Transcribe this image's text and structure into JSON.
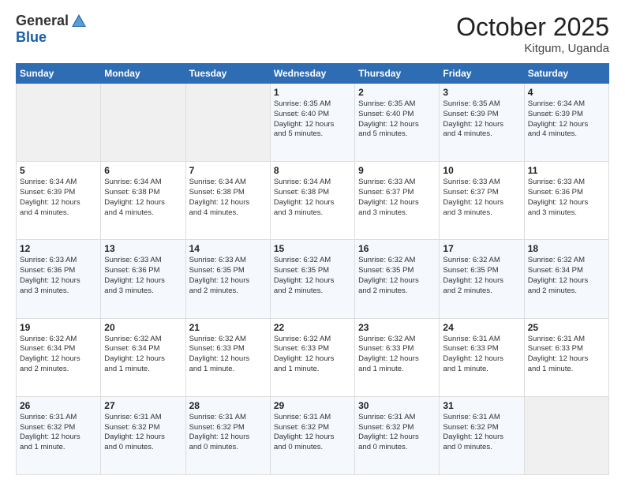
{
  "header": {
    "logo_general": "General",
    "logo_blue": "Blue",
    "month_title": "October 2025",
    "location": "Kitgum, Uganda"
  },
  "weekdays": [
    "Sunday",
    "Monday",
    "Tuesday",
    "Wednesday",
    "Thursday",
    "Friday",
    "Saturday"
  ],
  "weeks": [
    [
      {
        "day": "",
        "info": ""
      },
      {
        "day": "",
        "info": ""
      },
      {
        "day": "",
        "info": ""
      },
      {
        "day": "1",
        "info": "Sunrise: 6:35 AM\nSunset: 6:40 PM\nDaylight: 12 hours\nand 5 minutes."
      },
      {
        "day": "2",
        "info": "Sunrise: 6:35 AM\nSunset: 6:40 PM\nDaylight: 12 hours\nand 5 minutes."
      },
      {
        "day": "3",
        "info": "Sunrise: 6:35 AM\nSunset: 6:39 PM\nDaylight: 12 hours\nand 4 minutes."
      },
      {
        "day": "4",
        "info": "Sunrise: 6:34 AM\nSunset: 6:39 PM\nDaylight: 12 hours\nand 4 minutes."
      }
    ],
    [
      {
        "day": "5",
        "info": "Sunrise: 6:34 AM\nSunset: 6:39 PM\nDaylight: 12 hours\nand 4 minutes."
      },
      {
        "day": "6",
        "info": "Sunrise: 6:34 AM\nSunset: 6:38 PM\nDaylight: 12 hours\nand 4 minutes."
      },
      {
        "day": "7",
        "info": "Sunrise: 6:34 AM\nSunset: 6:38 PM\nDaylight: 12 hours\nand 4 minutes."
      },
      {
        "day": "8",
        "info": "Sunrise: 6:34 AM\nSunset: 6:38 PM\nDaylight: 12 hours\nand 3 minutes."
      },
      {
        "day": "9",
        "info": "Sunrise: 6:33 AM\nSunset: 6:37 PM\nDaylight: 12 hours\nand 3 minutes."
      },
      {
        "day": "10",
        "info": "Sunrise: 6:33 AM\nSunset: 6:37 PM\nDaylight: 12 hours\nand 3 minutes."
      },
      {
        "day": "11",
        "info": "Sunrise: 6:33 AM\nSunset: 6:36 PM\nDaylight: 12 hours\nand 3 minutes."
      }
    ],
    [
      {
        "day": "12",
        "info": "Sunrise: 6:33 AM\nSunset: 6:36 PM\nDaylight: 12 hours\nand 3 minutes."
      },
      {
        "day": "13",
        "info": "Sunrise: 6:33 AM\nSunset: 6:36 PM\nDaylight: 12 hours\nand 3 minutes."
      },
      {
        "day": "14",
        "info": "Sunrise: 6:33 AM\nSunset: 6:35 PM\nDaylight: 12 hours\nand 2 minutes."
      },
      {
        "day": "15",
        "info": "Sunrise: 6:32 AM\nSunset: 6:35 PM\nDaylight: 12 hours\nand 2 minutes."
      },
      {
        "day": "16",
        "info": "Sunrise: 6:32 AM\nSunset: 6:35 PM\nDaylight: 12 hours\nand 2 minutes."
      },
      {
        "day": "17",
        "info": "Sunrise: 6:32 AM\nSunset: 6:35 PM\nDaylight: 12 hours\nand 2 minutes."
      },
      {
        "day": "18",
        "info": "Sunrise: 6:32 AM\nSunset: 6:34 PM\nDaylight: 12 hours\nand 2 minutes."
      }
    ],
    [
      {
        "day": "19",
        "info": "Sunrise: 6:32 AM\nSunset: 6:34 PM\nDaylight: 12 hours\nand 2 minutes."
      },
      {
        "day": "20",
        "info": "Sunrise: 6:32 AM\nSunset: 6:34 PM\nDaylight: 12 hours\nand 1 minute."
      },
      {
        "day": "21",
        "info": "Sunrise: 6:32 AM\nSunset: 6:33 PM\nDaylight: 12 hours\nand 1 minute."
      },
      {
        "day": "22",
        "info": "Sunrise: 6:32 AM\nSunset: 6:33 PM\nDaylight: 12 hours\nand 1 minute."
      },
      {
        "day": "23",
        "info": "Sunrise: 6:32 AM\nSunset: 6:33 PM\nDaylight: 12 hours\nand 1 minute."
      },
      {
        "day": "24",
        "info": "Sunrise: 6:31 AM\nSunset: 6:33 PM\nDaylight: 12 hours\nand 1 minute."
      },
      {
        "day": "25",
        "info": "Sunrise: 6:31 AM\nSunset: 6:33 PM\nDaylight: 12 hours\nand 1 minute."
      }
    ],
    [
      {
        "day": "26",
        "info": "Sunrise: 6:31 AM\nSunset: 6:32 PM\nDaylight: 12 hours\nand 1 minute."
      },
      {
        "day": "27",
        "info": "Sunrise: 6:31 AM\nSunset: 6:32 PM\nDaylight: 12 hours\nand 0 minutes."
      },
      {
        "day": "28",
        "info": "Sunrise: 6:31 AM\nSunset: 6:32 PM\nDaylight: 12 hours\nand 0 minutes."
      },
      {
        "day": "29",
        "info": "Sunrise: 6:31 AM\nSunset: 6:32 PM\nDaylight: 12 hours\nand 0 minutes."
      },
      {
        "day": "30",
        "info": "Sunrise: 6:31 AM\nSunset: 6:32 PM\nDaylight: 12 hours\nand 0 minutes."
      },
      {
        "day": "31",
        "info": "Sunrise: 6:31 AM\nSunset: 6:32 PM\nDaylight: 12 hours\nand 0 minutes."
      },
      {
        "day": "",
        "info": ""
      }
    ]
  ]
}
